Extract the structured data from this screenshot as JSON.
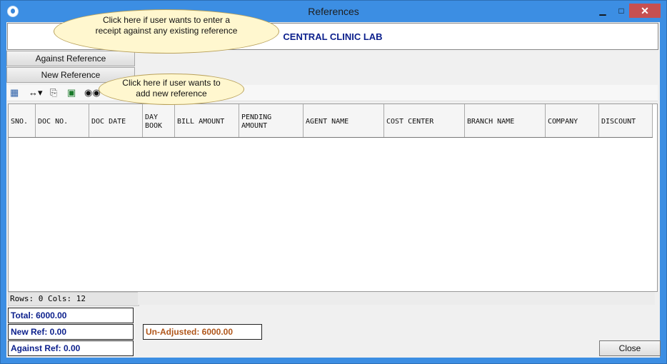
{
  "window": {
    "title": "References"
  },
  "company": "CENTRAL CLINIC LAB",
  "buttons": {
    "against_reference": "Against Reference",
    "new_reference": "New Reference",
    "close": "Close"
  },
  "callouts": {
    "against": "Click here if user wants to enter a receipt against any existing reference",
    "new": "Click here if user wants to add new reference"
  },
  "grid": {
    "columns": [
      "SNO.",
      "DOC NO.",
      "DOC DATE",
      "DAY BOOK",
      "BILL AMOUNT",
      "PENDING AMOUNT",
      "AGENT NAME",
      "COST CENTER",
      "BRANCH NAME",
      "COMPANY",
      "DISCOUNT"
    ],
    "status": "Rows: 0  Cols: 12"
  },
  "totals": {
    "total": "Total: 6000.00",
    "new_ref": "New Ref: 0.00",
    "against_ref": "Against Ref: 0.00",
    "unadjusted": "Un-Adjusted: 6000.00"
  },
  "colors": {
    "titlebar": "#3c8ee3",
    "company_text": "#0b1f8c",
    "unadjusted_text": "#b0561a"
  },
  "icons": [
    "app-icon",
    "minimize-icon",
    "maximize-icon",
    "close-icon",
    "grid-icon",
    "column-resize-icon",
    "copy-icon",
    "excel-icon",
    "find-icon"
  ]
}
